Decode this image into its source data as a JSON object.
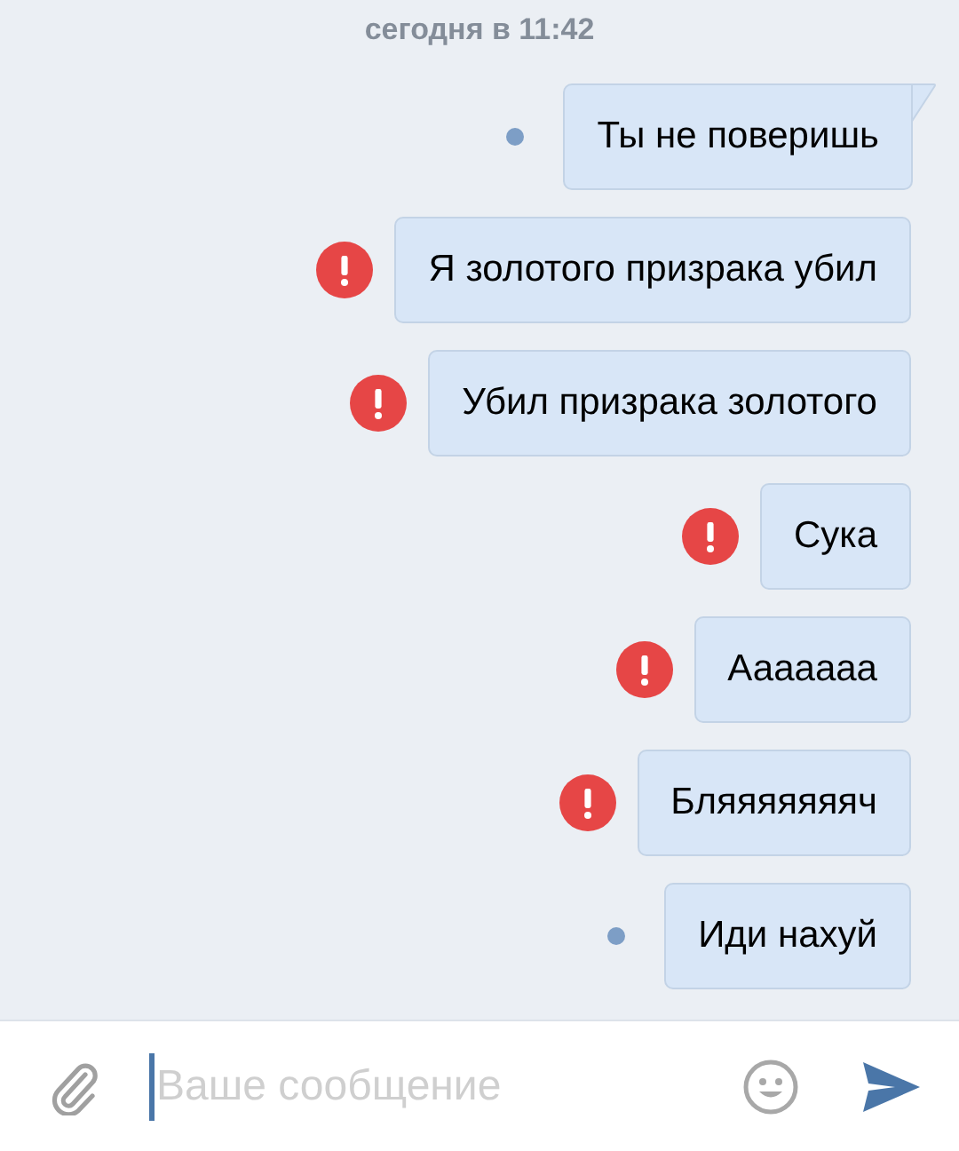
{
  "date_divider": "сегодня в 11:42",
  "messages": [
    {
      "text": "Ты не поверишь",
      "kind": "unread",
      "tail": true
    },
    {
      "text": "Я золотого призрака убил",
      "kind": "error",
      "tail": false
    },
    {
      "text": "Убил призрака золотого",
      "kind": "error",
      "tail": false
    },
    {
      "text": "Сука",
      "kind": "error",
      "tail": false
    },
    {
      "text": "Ааааааа",
      "kind": "error",
      "tail": false
    },
    {
      "text": "Бляяяяяяяч",
      "kind": "error",
      "tail": false
    },
    {
      "text": "Иди нахуй",
      "kind": "unread",
      "tail": false
    }
  ],
  "composer": {
    "placeholder": "Ваше сообщение"
  }
}
